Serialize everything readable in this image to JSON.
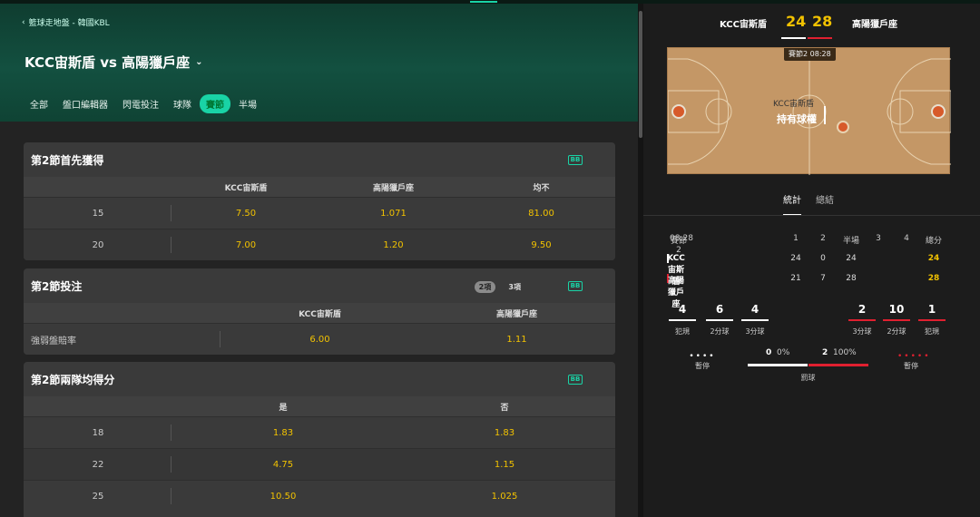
{
  "breadcrumb": "籃球走地盤 - 韓國KBL",
  "match_title": "KCC宙斯盾 vs 高陽獵戶座",
  "tabs": [
    "全部",
    "盤口編輯器",
    "閃電投注",
    "球隊",
    "賽節",
    "半場"
  ],
  "active_tab": 4,
  "bb_label": "BB",
  "markets": [
    {
      "title": "第2節首先獲得",
      "columns": [
        "KCC宙斯盾",
        "高陽獵戶座",
        "均不"
      ],
      "rows": [
        {
          "label": "15",
          "odds": [
            "7.50",
            "1.071",
            "81.00"
          ]
        },
        {
          "label": "20",
          "odds": [
            "7.00",
            "1.20",
            "9.50"
          ]
        }
      ]
    },
    {
      "title": "第2節投注",
      "toggle": [
        "2項",
        "3項"
      ],
      "columns": [
        "KCC宙斯盾",
        "高陽獵戶座"
      ],
      "rows": [
        {
          "label": "強弱盤賠率",
          "odds": [
            "6.00",
            "1.11"
          ]
        }
      ]
    },
    {
      "title": "第2節兩隊均得分",
      "columns": [
        "是",
        "否"
      ],
      "rows": [
        {
          "label": "18",
          "odds": [
            "1.83",
            "1.83"
          ]
        },
        {
          "label": "22",
          "odds": [
            "4.75",
            "1.15"
          ]
        },
        {
          "label": "25",
          "odds": [
            "10.50",
            "1.025"
          ]
        }
      ]
    }
  ],
  "scoreboard": {
    "home": "KCC宙斯盾",
    "away": "高陽獵戶座",
    "home_score": "24",
    "away_score": "28",
    "clock_period": "賽節2",
    "clock_time": "08:28",
    "possession_team": "KCC宙斯盾",
    "possession_text": "持有球權"
  },
  "stat_tabs": [
    "統計",
    "總結"
  ],
  "table": {
    "header_period": "賽節2",
    "header_time": "08:28",
    "cols": [
      "1",
      "2",
      "半場",
      "3",
      "4",
      "總分"
    ],
    "rows": [
      {
        "team": "KCC宙斯盾",
        "vals": [
          "24",
          "0",
          "24",
          "",
          "",
          "24"
        ]
      },
      {
        "team": "高陽獵戶座",
        "vals": [
          "21",
          "7",
          "28",
          "",
          "",
          "28"
        ]
      }
    ]
  },
  "stats": {
    "home": [
      {
        "n": "4",
        "l": "犯規"
      },
      {
        "n": "6",
        "l": "2分球"
      },
      {
        "n": "4",
        "l": "3分球"
      }
    ],
    "away": [
      {
        "n": "2",
        "l": "3分球"
      },
      {
        "n": "10",
        "l": "2分球"
      },
      {
        "n": "1",
        "l": "犯規"
      }
    ],
    "timeout_label": "暫停",
    "ft_label": "罰球",
    "home_ft": "0",
    "home_ft_pct": "0%",
    "away_ft": "2",
    "away_ft_pct": "100%"
  },
  "colors": {
    "accent": "#19d3a6",
    "odds": "#f2c200",
    "away": "#e02030"
  }
}
